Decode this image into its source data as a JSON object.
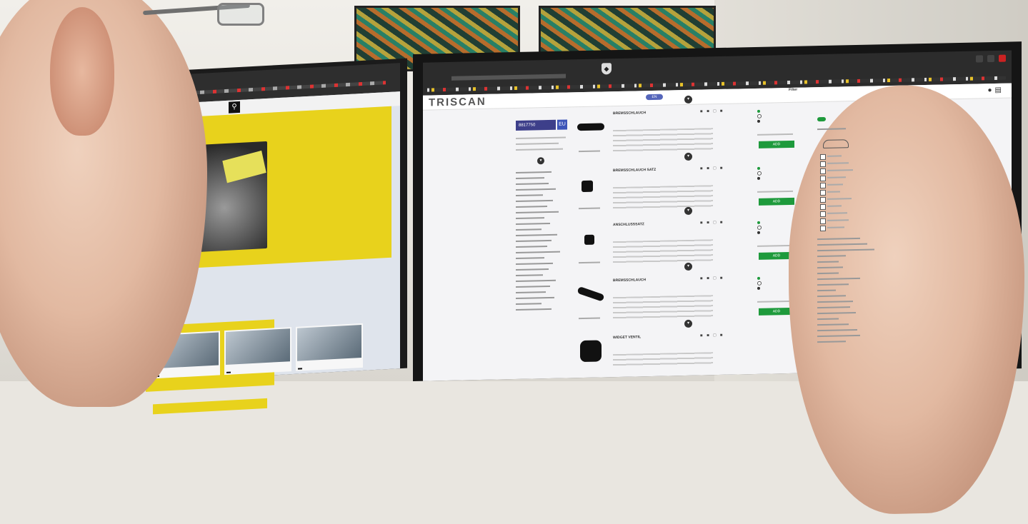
{
  "scene": {
    "description_free": true
  },
  "right_monitor": {
    "brand": "TRISCAN",
    "nav_pill": "EN",
    "part_number": "8817750",
    "part_flag": "EU",
    "add_button_label": "ADD",
    "products": [
      {
        "title": "BREMSSCHLAUCH"
      },
      {
        "title": "BREMSSCHLAUCH SATZ"
      },
      {
        "title": "ANSCHLUSSSATZ"
      },
      {
        "title": "BREMSSCHLAUCH"
      },
      {
        "title": "WIDGET VENTIL"
      }
    ],
    "filter_heading": "Filter"
  },
  "left_monitor": {
    "card_labels": [
      "",
      "",
      ""
    ]
  },
  "colors": {
    "brand_yellow": "#e8d21c",
    "add_green": "#1e9a3c",
    "part_blue": "#3d3f8a"
  },
  "icons": [
    "search-icon",
    "user-icon",
    "cart-icon",
    "shield-icon"
  ]
}
